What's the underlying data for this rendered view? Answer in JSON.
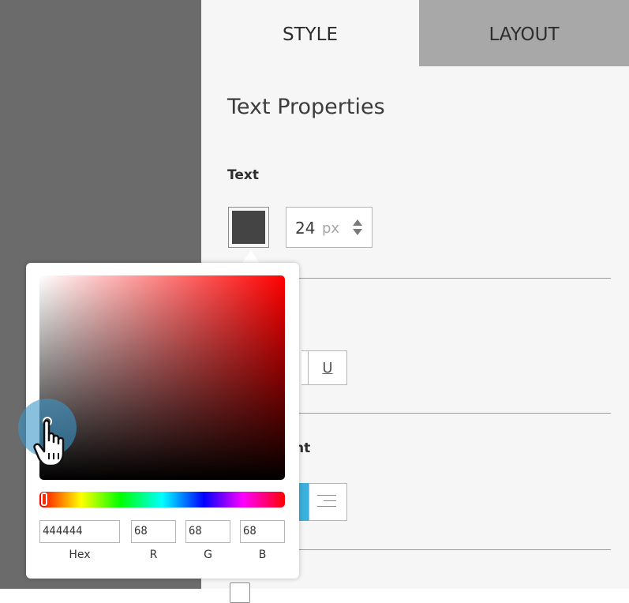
{
  "tabs": [
    {
      "label": "STYLE",
      "active": true
    },
    {
      "label": "LAYOUT",
      "active": false
    }
  ],
  "section_title": "Text Properties",
  "text_group": {
    "label": "Text",
    "color": "#444444",
    "font_size_value": "24",
    "font_size_unit": "px"
  },
  "style_group": {
    "underline_label": "U"
  },
  "alignment_group": {
    "label_partial": "nt",
    "active_color": "#3ab0dc"
  },
  "color_picker": {
    "hex_value": "444444",
    "r_value": "68",
    "g_value": "68",
    "b_value": "68",
    "hex_label": "Hex",
    "r_label": "R",
    "g_label": "G",
    "b_label": "B",
    "hue_color": "#ff0000"
  },
  "colors": {
    "accent": "#3ab0dc",
    "left_pane": "#6b6b6b",
    "inactive_tab": "#a8a8a8"
  }
}
